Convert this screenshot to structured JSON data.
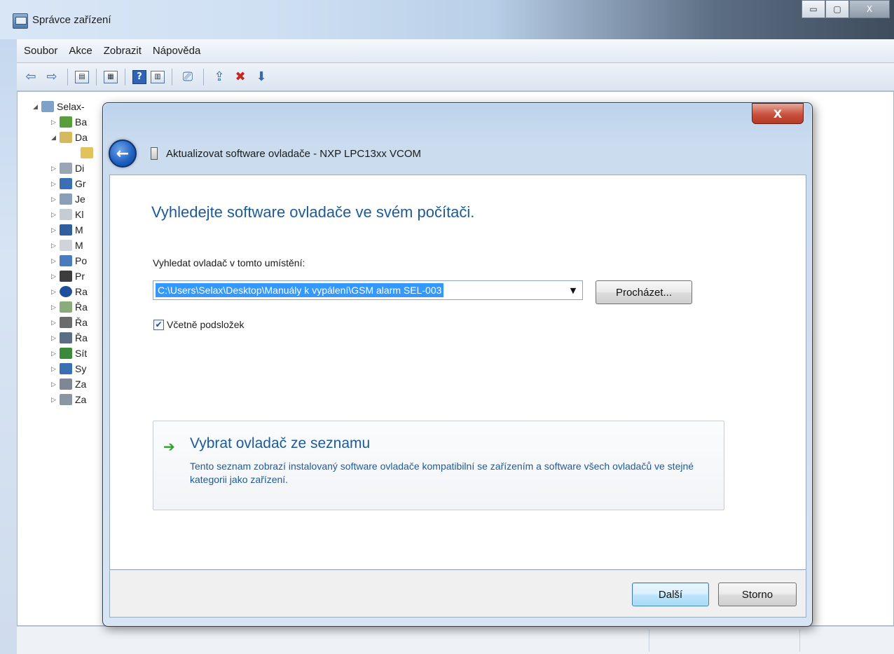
{
  "window": {
    "title": "Správce zařízení",
    "caption": {
      "minimize": "▭",
      "maximize": "▢",
      "close": "X"
    }
  },
  "menubar": [
    "Soubor",
    "Akce",
    "Zobrazit",
    "Nápověda"
  ],
  "toolbar": {
    "icons": [
      "back-arrow-icon",
      "forward-arrow-icon",
      "properties-icon",
      "console-icon",
      "help-icon",
      "view-icon",
      "scan-hardware-icon",
      "update-driver-icon",
      "uninstall-icon",
      "enable-device-icon"
    ]
  },
  "tree": {
    "root": "Selax-",
    "items": [
      "Ba",
      "Da",
      "",
      "Di",
      "Gr",
      "Je",
      "Kl",
      "M",
      "M",
      "Po",
      "Pr",
      "Ra",
      "Řa",
      "Řa",
      "Řa",
      "Sít",
      "Sy",
      "Za",
      "Za"
    ]
  },
  "dialog": {
    "close": "X",
    "title": "Aktualizovat software ovladače - NXP LPC13xx VCOM",
    "heading": "Vyhledejte software ovladače ve svém počítači.",
    "location_label": "Vyhledat ovladač v tomto umístění:",
    "location_value": "C:\\Users\\Selax\\Desktop\\Manuály k vypálení\\GSM alarm SEL-003",
    "browse": "Procházet...",
    "include_subfolders": "Včetně podsložek",
    "include_subfolders_checked": true,
    "pick": {
      "title": "Vybrat ovladač ze seznamu",
      "desc": "Tento seznam zobrazí instalovaný software ovladače kompatibilní se zařízením a software všech ovladačů ve stejné kategorii jako zařízení."
    },
    "next": "Další",
    "cancel": "Storno"
  }
}
